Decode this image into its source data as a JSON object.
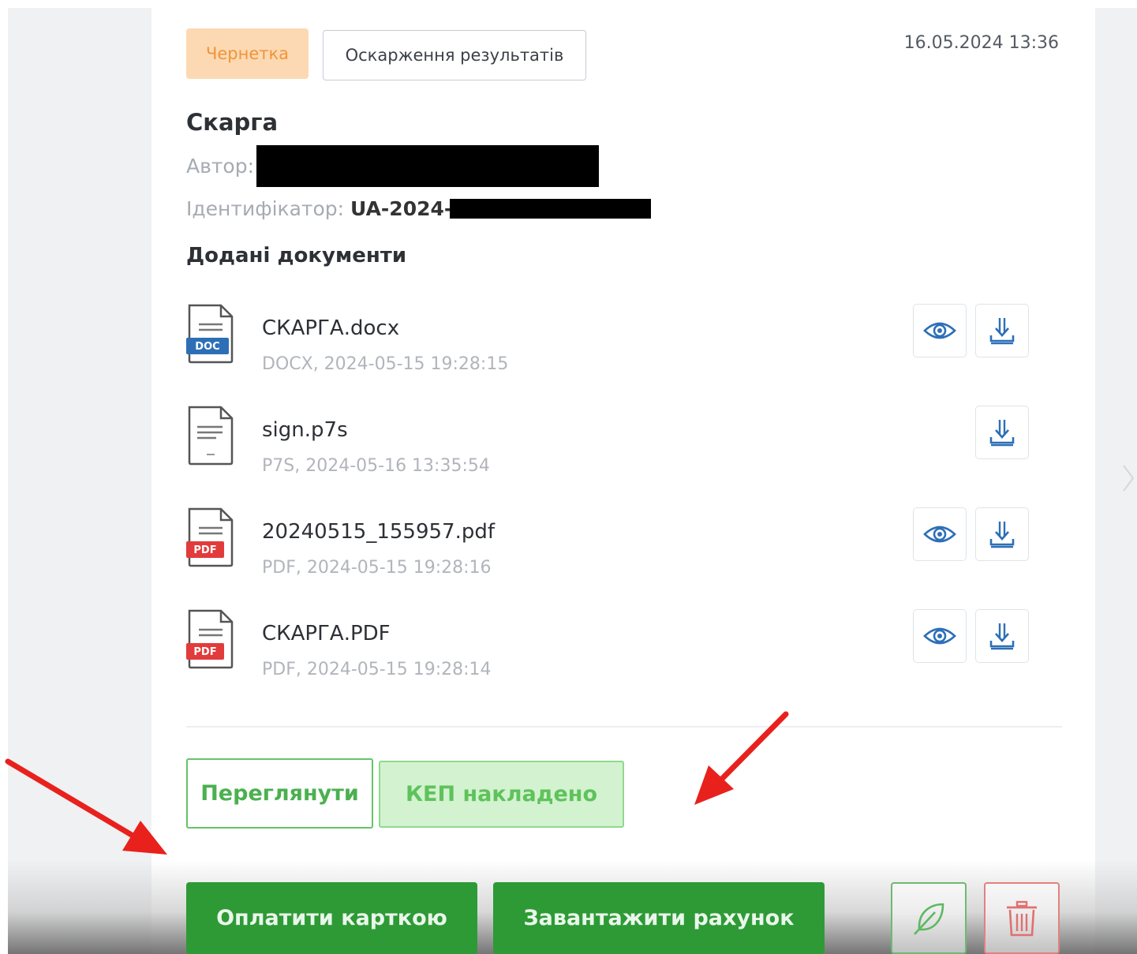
{
  "header": {
    "status_badge": "Чернетка",
    "type_badge": "Оскарження результатів",
    "date": "16.05.2024 13:36"
  },
  "complaint": {
    "title": "Скарга",
    "author_label": "Автор:",
    "id_label": "Ідентифікатор:",
    "id_value": "UA-2024-"
  },
  "documents": {
    "section_title": "Додані документи",
    "items": [
      {
        "name": "СКАРГА.docx",
        "info": "DOCX, 2024-05-15 19:28:15",
        "badge": "DOC",
        "icon": "doc-file-icon"
      },
      {
        "name": "sign.p7s",
        "info": "P7S, 2024-05-16 13:35:54",
        "badge": "",
        "icon": "generic-file-icon"
      },
      {
        "name": "20240515_155957.pdf",
        "info": "PDF, 2024-05-15 19:28:16",
        "badge": "PDF",
        "icon": "pdf-file-icon"
      },
      {
        "name": "СКАРГА.PDF",
        "info": "PDF, 2024-05-15 19:28:14",
        "badge": "PDF",
        "icon": "pdf-file-icon"
      }
    ]
  },
  "actions": {
    "view_label": "Переглянути",
    "kep_label": "КЕП накладено",
    "pay_label": "Оплатити карткою",
    "invoice_label": "Завантажити рахунок"
  },
  "colors": {
    "draft_badge_bg": "#fcd9b2",
    "draft_badge_text": "#f0943a",
    "primary_green": "#2d9a36",
    "kep_bg": "#d3f2cf",
    "danger": "#e38080",
    "annotation_arrow": "#e8211d",
    "icon_blue": "#2d6fb7"
  }
}
